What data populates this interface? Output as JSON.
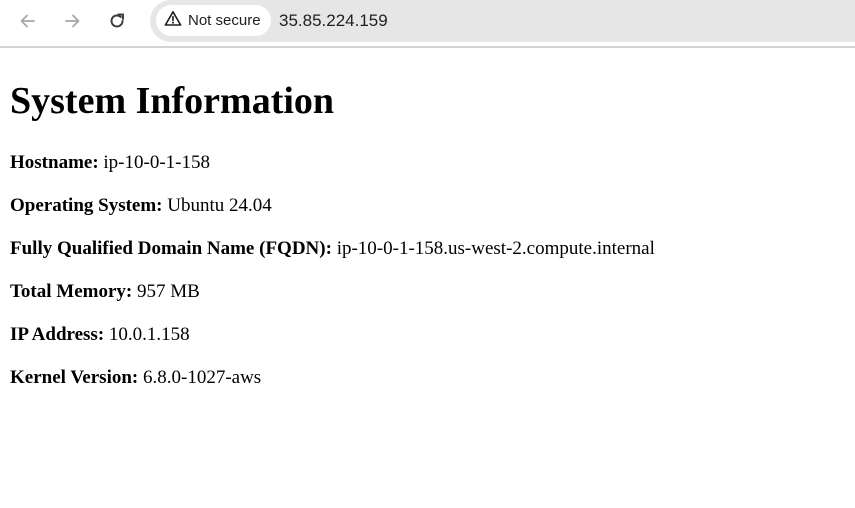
{
  "browser": {
    "security_label": "Not secure",
    "url": "35.85.224.159",
    "icons": {
      "back": "arrow-left-icon",
      "forward": "arrow-right-icon",
      "reload": "reload-icon",
      "security": "warning-triangle-icon"
    }
  },
  "page": {
    "title": "System Information",
    "fields": [
      {
        "label": "Hostname:",
        "value": "ip-10-0-1-158"
      },
      {
        "label": "Operating System:",
        "value": "Ubuntu 24.04"
      },
      {
        "label": "Fully Qualified Domain Name (FQDN):",
        "value": "ip-10-0-1-158.us-west-2.compute.internal"
      },
      {
        "label": "Total Memory:",
        "value": "957 MB"
      },
      {
        "label": "IP Address:",
        "value": "10.0.1.158"
      },
      {
        "label": "Kernel Version:",
        "value": "6.8.0-1027-aws"
      }
    ]
  }
}
